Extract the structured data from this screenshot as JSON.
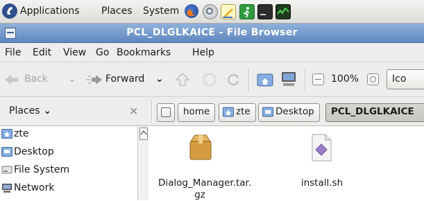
{
  "panel": {
    "menus": [
      "Applications",
      "Places",
      "System"
    ],
    "icons": [
      "firefox-icon",
      "network-icon",
      "text-editor-icon",
      "exit-icon",
      "terminal-icon",
      "system-monitor-icon"
    ]
  },
  "window": {
    "title": "PCL_DLGLKAICE - File Browser"
  },
  "menubar": {
    "items": [
      "File",
      "Edit",
      "View",
      "Go",
      "Bookmarks",
      "Help"
    ]
  },
  "toolbar": {
    "back_label": "Back",
    "forward_label": "Forward",
    "zoom_value": "100%",
    "view_select": "Ico"
  },
  "location": {
    "places_label": "Places",
    "crumbs": [
      "home",
      "zte",
      "Desktop",
      "PCL_DLGLKAICE"
    ]
  },
  "sidebar": {
    "items": [
      "zte",
      "Desktop",
      "File System",
      "Network"
    ]
  },
  "files": [
    {
      "name_line1": "Dialog_Manager.tar.",
      "name_line2": "gz",
      "icon": "archive-icon"
    },
    {
      "name_line1": "install.sh",
      "name_line2": "",
      "icon": "script-icon"
    }
  ],
  "colors": {
    "titlebar": "#5f86c0",
    "folder_blue": "#6f9bd3"
  }
}
